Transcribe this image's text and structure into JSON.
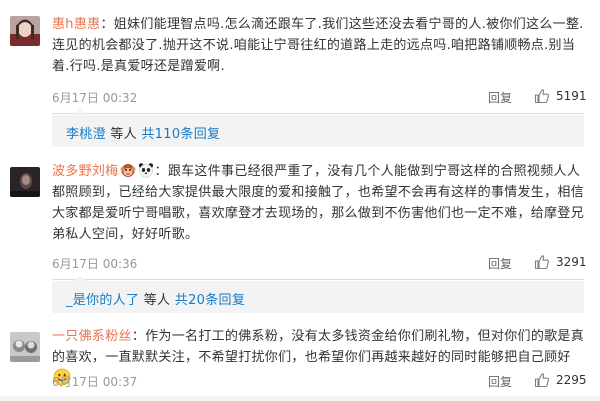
{
  "comments": [
    {
      "username": "惠h惠惠",
      "text": "：姐妹们能理智点吗.怎么滴还跟车了.我们这些还没去看宁哥的人.被你们这么一整.连见的机会都没了.抛开这不说.咱能让宁哥往红的道路上走的远点吗.咱把路铺顺畅点.别当着.行吗.是真爱呀还是蹭爱啊.",
      "time": "6月17日 00:32",
      "reply_label": "回复",
      "likes": "5191",
      "sub": {
        "user": "李桃澄",
        "mid": " 等人 ",
        "more": "共110条回复"
      }
    },
    {
      "username": "波多野刘梅",
      "emojis": [
        "monkey-face-emoji",
        "panda-face-emoji"
      ],
      "text": "：跟车这件事已经很严重了，没有几个人能做到宁哥这样的合照视频人人都照顾到，已经给大家提供最大限度的爱和接触了，也希望不会再有这样的事情发生，相信大家都是爱听宁哥唱歌，喜欢摩登才去现场的，那么做到不伤害他们也一定不难，给摩登兄弟私人空间，好好听歌。",
      "time": "6月17日 00:36",
      "reply_label": "回复",
      "likes": "3291",
      "sub": {
        "user": "_是你的人了",
        "mid": " 等人 ",
        "more": "共20条回复"
      }
    },
    {
      "username": "一只佛系粉丝",
      "text": "：作为一名打工的佛系粉，没有太多钱资金给你们刷礼物，但对你们的歌是真的喜欢，一直默默关注，不希望打扰你们，也希望你们再越来越好的同时能够把自己顾好",
      "end_emoji": "smile-emoji",
      "time": "6月17日 00:37",
      "reply_label": "回复",
      "likes": "2295"
    }
  ],
  "colors": {
    "username": "#eb7350",
    "link": "#1a7bc4",
    "meta": "#999999",
    "subbox": "#f3f3f3"
  }
}
